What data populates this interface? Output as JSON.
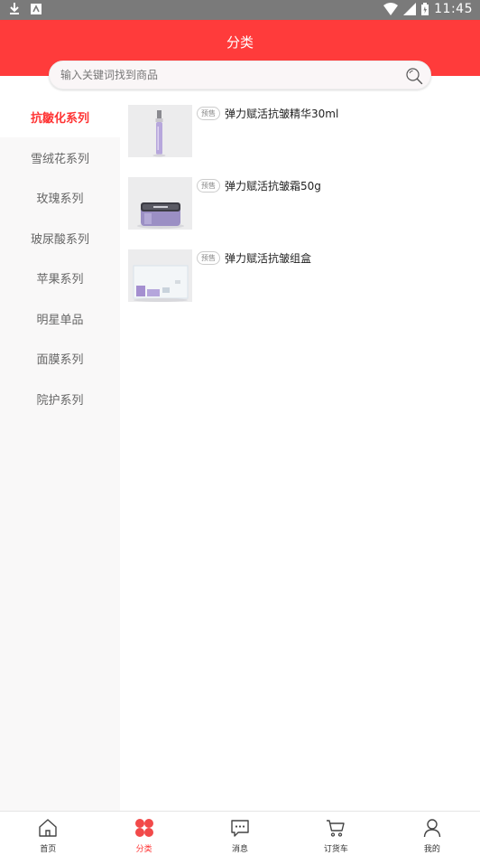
{
  "status_bar": {
    "time": "11:45",
    "icons": [
      "download-icon",
      "app-icon",
      "wifi-icon",
      "signal-icon",
      "battery-icon"
    ]
  },
  "header": {
    "title": "分类"
  },
  "search": {
    "placeholder": "输入关键词找到商品",
    "icon": "search-icon"
  },
  "sidebar": {
    "items": [
      {
        "label": "抗皺化系列",
        "active": true
      },
      {
        "label": "雪绒花系列",
        "active": false
      },
      {
        "label": "玫瑰系列",
        "active": false
      },
      {
        "label": "玻尿酸系列",
        "active": false
      },
      {
        "label": "苹果系列",
        "active": false
      },
      {
        "label": "明星单品",
        "active": false
      },
      {
        "label": "面膜系列",
        "active": false
      },
      {
        "label": "院护系列",
        "active": false
      }
    ]
  },
  "products": [
    {
      "badge": "预售",
      "title": "弹力赋活抗皱精华30ml",
      "image": "serum-bottle"
    },
    {
      "badge": "预售",
      "title": "弹力赋活抗皱霜50g",
      "image": "cream-jar"
    },
    {
      "badge": "预售",
      "title": "弹力赋活抗皱组盒",
      "image": "gift-box"
    }
  ],
  "tabbar": {
    "tabs": [
      {
        "label": "首页",
        "icon": "home-icon",
        "active": false
      },
      {
        "label": "分类",
        "icon": "category-icon",
        "active": true
      },
      {
        "label": "消息",
        "icon": "message-icon",
        "active": false
      },
      {
        "label": "订货车",
        "icon": "cart-icon",
        "active": false
      },
      {
        "label": "我的",
        "icon": "profile-icon",
        "active": false
      }
    ]
  },
  "colors": {
    "brand": "#ff3b3b",
    "active_text": "#ff3333"
  }
}
